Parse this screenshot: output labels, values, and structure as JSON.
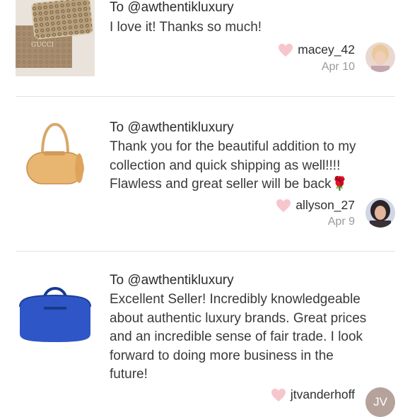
{
  "reviews": [
    {
      "recipient": "To @awthentikluxury",
      "text": "I love it! Thanks so much!",
      "username": "macey_42",
      "date": "Apr 10",
      "product": "Gucci wallet"
    },
    {
      "recipient": "To @awthentikluxury",
      "text_lines": [
        "Thank you for the beautiful addition to my",
        "collection and quick shipping as well!!!!",
        "Flawless and great seller will be back"
      ],
      "emoji": "🌹",
      "username": "allyson_27",
      "date": "Apr 9",
      "product": "Louis Vuitton Papillon bag"
    },
    {
      "recipient": "To @awthentikluxury",
      "text_lines": [
        "Excellent Seller! Incredibly knowledgeable",
        "about authentic luxury brands. Great prices",
        "and an incredible sense of fair trade. I look",
        "forward to doing more business in the",
        "future!"
      ],
      "username": "jtvanderhoff",
      "avatar_initials": "JV",
      "product": "Louis Vuitton Keepall bag"
    }
  ],
  "colors": {
    "heart": "#f6c6cc",
    "avatar_bg": "#b5a29a",
    "divider": "#e3e3e3"
  },
  "icons": {
    "like": "heart-icon"
  }
}
